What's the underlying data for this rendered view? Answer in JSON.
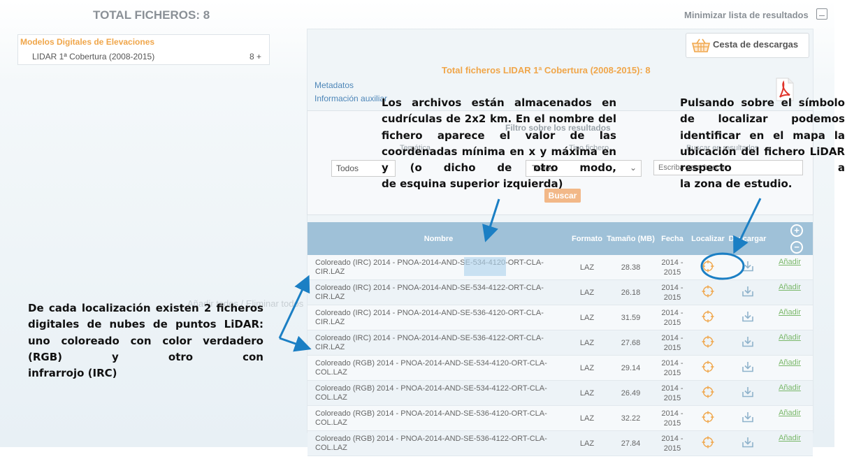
{
  "header": {
    "total_label": "TOTAL FICHEROS: 8",
    "minimize_label": "Minimizar lista de resultados"
  },
  "tree": {
    "category": "Modelos Digitales de Elevaciones",
    "item_label": "LIDAR 1ª Cobertura (2008-2015)",
    "item_count": "8 +"
  },
  "panel": {
    "cart_label": "Cesta de descargas",
    "total_files": "Total ficheros  LIDAR 1ª Cobertura (2008-2015): 8",
    "link_metadata": "Metadatos",
    "link_aux": "Información auxiliar"
  },
  "filter": {
    "title": "Filtro sobre los resultados",
    "tematica_label": "Temática",
    "tematica_value": "Todos",
    "tipo_label": "Tipo fichero",
    "tipo_value": "Todos",
    "search_label": "Buscar en resultados",
    "search_placeholder": "Escriba para buscar",
    "search_button": "Buscar"
  },
  "table": {
    "headers": {
      "name": "Nombre",
      "format": "Formato",
      "size": "Tamaño (MB)",
      "date": "Fecha",
      "locate": "Localizar",
      "download": "Descargar"
    },
    "rows": [
      {
        "name": "Coloreado (IRC) 2014 - PNOA-2014-AND-SE-534-4120-ORT-CLA-CIR.LAZ",
        "format": "LAZ",
        "size": "28.38",
        "date": "2014 - 2015",
        "add": "Añadir"
      },
      {
        "name": "Coloreado (IRC) 2014 - PNOA-2014-AND-SE-534-4122-ORT-CLA-CIR.LAZ",
        "format": "LAZ",
        "size": "26.18",
        "date": "2014 - 2015",
        "add": "Añadir"
      },
      {
        "name": "Coloreado (IRC) 2014 - PNOA-2014-AND-SE-536-4120-ORT-CLA-CIR.LAZ",
        "format": "LAZ",
        "size": "31.59",
        "date": "2014 - 2015",
        "add": "Añadir"
      },
      {
        "name": "Coloreado (IRC) 2014 - PNOA-2014-AND-SE-536-4122-ORT-CLA-CIR.LAZ",
        "format": "LAZ",
        "size": "27.68",
        "date": "2014 - 2015",
        "add": "Añadir"
      },
      {
        "name": "Coloreado (RGB) 2014 - PNOA-2014-AND-SE-534-4120-ORT-CLA-COL.LAZ",
        "format": "LAZ",
        "size": "29.14",
        "date": "2014 - 2015",
        "add": "Añadir"
      },
      {
        "name": "Coloreado (RGB) 2014 - PNOA-2014-AND-SE-534-4122-ORT-CLA-COL.LAZ",
        "format": "LAZ",
        "size": "26.49",
        "date": "2014 - 2015",
        "add": "Añadir"
      },
      {
        "name": "Coloreado (RGB) 2014 - PNOA-2014-AND-SE-536-4120-ORT-CLA-COL.LAZ",
        "format": "LAZ",
        "size": "32.22",
        "date": "2014 - 2015",
        "add": "Añadir"
      },
      {
        "name": "Coloreado (RGB) 2014 - PNOA-2014-AND-SE-536-4122-ORT-CLA-COL.LAZ",
        "format": "LAZ",
        "size": "27.84",
        "date": "2014 - 2015",
        "add": "Añadir"
      }
    ]
  },
  "zoom": {
    "plus": "+",
    "minus": "−"
  },
  "ghost_text": "Añadir todos / Eliminar todos",
  "annotations": {
    "center_lines": [
      "Los archivos están almacenados en",
      "cudrículas de 2x2 km. En el nombre",
      "del fichero aparece el valor de las",
      "coordenadas mínima en x y",
      "máxima en y (o dicho de otro modo,",
      "de esquina superior izquierda)"
    ],
    "right_lines": [
      "Pulsando sobre el",
      "símbolo de localizar",
      "podemos identificar en el",
      "mapa la ubicación del",
      "fichero LiDAR respecto a",
      "la zona de estudio."
    ],
    "left_lines": [
      "De cada localización existen 2",
      "ficheros digitales de nubes de",
      "puntos LiDAR: uno coloreado con",
      "color verdadero (RGB) y otro con",
      "infrarrojo (IRC)"
    ]
  },
  "colors": {
    "accent_orange": "#f0a64a",
    "table_header": "#9fc1d8",
    "link_blue": "#4d86b8",
    "annotation_arrow": "#1b7fc4",
    "add_green": "#7ab86a"
  },
  "icons": {
    "locate": "crosshair-icon",
    "download": "download-icon",
    "cart": "basket-icon",
    "pdf": "pdf-icon",
    "zoom_in": "plus-circle-icon",
    "zoom_out": "minus-circle-icon"
  }
}
